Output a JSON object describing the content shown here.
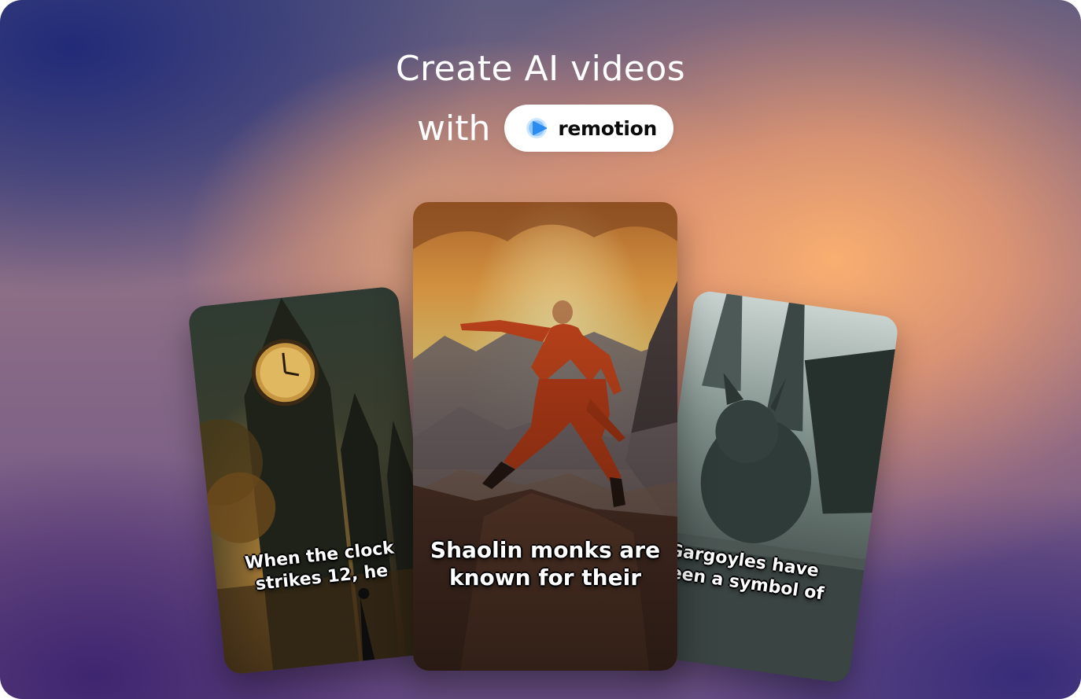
{
  "hero": {
    "headline": "Create AI videos",
    "with_label": "with",
    "brand": {
      "name": "remotion",
      "logo_icon": "remotion-play-logo-icon",
      "accent": "#2a8cf0"
    }
  },
  "cards": {
    "left": {
      "caption_line1": "When the clock",
      "caption_line2": "strikes 12, he",
      "scene": "gothic-clock-tower-street"
    },
    "center": {
      "caption_line1": "Shaolin monks are",
      "caption_line2": "known for their",
      "scene": "shaolin-monk-on-cliff-at-sunset"
    },
    "right": {
      "caption_line1": "Gargoyles have",
      "caption_line2": "been a symbol of",
      "scene": "stone-gargoyle-on-cathedral"
    }
  },
  "colors": {
    "background_top_left": "#1e2878",
    "background_glow": "#ffb26e",
    "background_bottom": "#3c2370"
  }
}
